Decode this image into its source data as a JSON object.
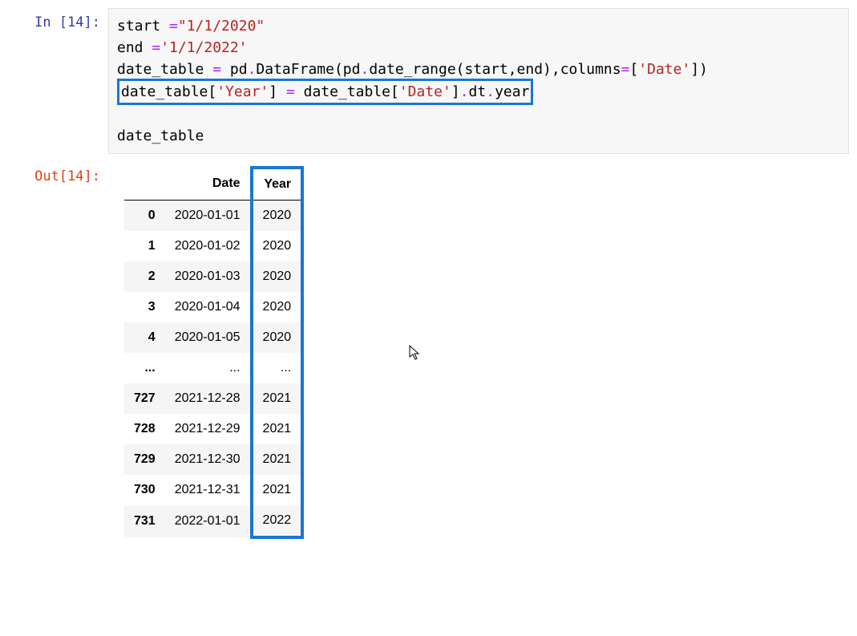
{
  "cell_in_prompt": "In [14]:",
  "cell_out_prompt": "Out[14]:",
  "code": {
    "line1a": "start ",
    "line1b": "=",
    "line1c": "\"1/1/2020\"",
    "line2a": "end ",
    "line2b": "=",
    "line2c": "'1/1/2022'",
    "line3a": "date_table ",
    "line3b": "=",
    "line3c": " pd",
    "line3d": ".",
    "line3e": "DataFrame(pd",
    "line3f": ".",
    "line3g": "date_range(start,end),columns",
    "line3h": "=",
    "line3i": "[",
    "line3j": "'Date'",
    "line3k": "])",
    "line4a": "date_table[",
    "line4b": "'Year'",
    "line4c": "] ",
    "line4d": "=",
    "line4e": " date_table[",
    "line4f": "'Date'",
    "line4g": "]",
    "line4h": ".",
    "line4i": "dt",
    "line4j": ".",
    "line4k": "year",
    "line5": "",
    "line6": "date_table"
  },
  "table": {
    "columns": [
      "",
      "Date",
      "Year"
    ],
    "rows": [
      {
        "idx": "0",
        "date": "2020-01-01",
        "year": "2020"
      },
      {
        "idx": "1",
        "date": "2020-01-02",
        "year": "2020"
      },
      {
        "idx": "2",
        "date": "2020-01-03",
        "year": "2020"
      },
      {
        "idx": "3",
        "date": "2020-01-04",
        "year": "2020"
      },
      {
        "idx": "4",
        "date": "2020-01-05",
        "year": "2020"
      },
      {
        "idx": "...",
        "date": "...",
        "year": "..."
      },
      {
        "idx": "727",
        "date": "2021-12-28",
        "year": "2021"
      },
      {
        "idx": "728",
        "date": "2021-12-29",
        "year": "2021"
      },
      {
        "idx": "729",
        "date": "2021-12-30",
        "year": "2021"
      },
      {
        "idx": "730",
        "date": "2021-12-31",
        "year": "2021"
      },
      {
        "idx": "731",
        "date": "2022-01-01",
        "year": "2022"
      }
    ]
  }
}
